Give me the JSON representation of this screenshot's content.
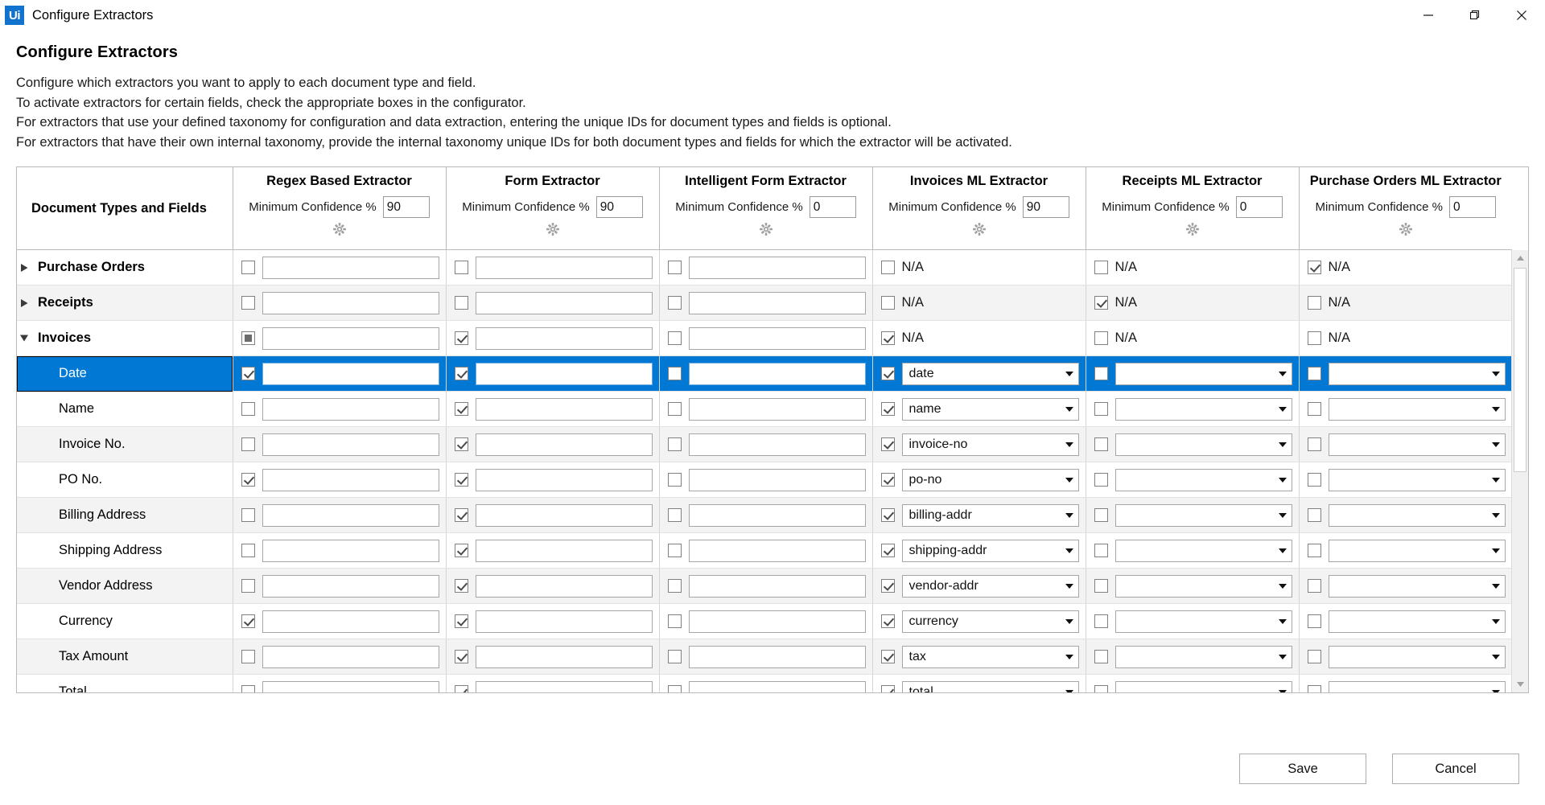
{
  "titlebar": {
    "logo_text": "Ui",
    "title": "Configure Extractors",
    "minimize_icon": "minimize-icon",
    "restore_icon": "restore-icon",
    "close_icon": "close-icon"
  },
  "page": {
    "title": "Configure Extractors",
    "description_lines": [
      "Configure which extractors you want to apply to each document type and field.",
      "To activate extractors for certain fields, check the appropriate boxes in the configurator.",
      "For extractors that use your defined taxonomy for configuration and data extraction, entering the unique IDs for document types and fields is optional.",
      "For extractors that have their own internal taxonomy, provide the internal taxonomy unique IDs for both document types and fields for which the extractor will be activated."
    ]
  },
  "grid": {
    "first_column_header": "Document Types and Fields",
    "confidence_label": "Minimum Confidence %",
    "settings_icon": "gear-icon",
    "columns": [
      {
        "title": "Regex Based Extractor",
        "confidence": "90",
        "type": "text"
      },
      {
        "title": "Form Extractor",
        "confidence": "90",
        "type": "text"
      },
      {
        "title": "Intelligent Form Extractor",
        "confidence": "0",
        "type": "text"
      },
      {
        "title": "Invoices ML Extractor",
        "confidence": "90",
        "type": "combo"
      },
      {
        "title": "Receipts ML Extractor",
        "confidence": "0",
        "type": "combo"
      },
      {
        "title": "Purchase Orders ML Extractor",
        "confidence": "0",
        "type": "combo"
      }
    ],
    "rows": [
      {
        "label": "Purchase Orders",
        "level": "group",
        "expanded": false,
        "expander_icon": "triangle-right-icon",
        "selected": false,
        "cells": [
          {
            "checked": "unchecked",
            "value": ""
          },
          {
            "checked": "unchecked",
            "value": ""
          },
          {
            "checked": "unchecked",
            "value": ""
          },
          {
            "checked": "unchecked",
            "value": "N/A"
          },
          {
            "checked": "unchecked",
            "value": "N/A"
          },
          {
            "checked": "checked",
            "value": "N/A"
          }
        ]
      },
      {
        "label": "Receipts",
        "level": "group",
        "expanded": false,
        "expander_icon": "triangle-right-icon",
        "selected": false,
        "cells": [
          {
            "checked": "unchecked",
            "value": ""
          },
          {
            "checked": "unchecked",
            "value": ""
          },
          {
            "checked": "unchecked",
            "value": ""
          },
          {
            "checked": "unchecked",
            "value": "N/A"
          },
          {
            "checked": "checked",
            "value": "N/A"
          },
          {
            "checked": "unchecked",
            "value": "N/A"
          }
        ]
      },
      {
        "label": "Invoices",
        "level": "group",
        "expanded": true,
        "expander_icon": "triangle-down-icon",
        "selected": false,
        "cells": [
          {
            "checked": "indeterminate",
            "value": ""
          },
          {
            "checked": "checked",
            "value": ""
          },
          {
            "checked": "unchecked",
            "value": ""
          },
          {
            "checked": "checked",
            "value": "N/A"
          },
          {
            "checked": "unchecked",
            "value": "N/A"
          },
          {
            "checked": "unchecked",
            "value": "N/A"
          }
        ]
      },
      {
        "label": "Date",
        "level": "child",
        "selected": true,
        "cells": [
          {
            "checked": "checked",
            "value": ""
          },
          {
            "checked": "checked",
            "value": ""
          },
          {
            "checked": "unchecked",
            "value": ""
          },
          {
            "checked": "checked",
            "value": "date"
          },
          {
            "checked": "unchecked",
            "value": ""
          },
          {
            "checked": "unchecked",
            "value": ""
          }
        ]
      },
      {
        "label": "Name",
        "level": "child",
        "selected": false,
        "cells": [
          {
            "checked": "unchecked",
            "value": ""
          },
          {
            "checked": "checked",
            "value": ""
          },
          {
            "checked": "unchecked",
            "value": ""
          },
          {
            "checked": "checked",
            "value": "name"
          },
          {
            "checked": "unchecked",
            "value": ""
          },
          {
            "checked": "unchecked",
            "value": ""
          }
        ]
      },
      {
        "label": "Invoice No.",
        "level": "child",
        "selected": false,
        "cells": [
          {
            "checked": "unchecked",
            "value": ""
          },
          {
            "checked": "checked",
            "value": ""
          },
          {
            "checked": "unchecked",
            "value": ""
          },
          {
            "checked": "checked",
            "value": "invoice-no"
          },
          {
            "checked": "unchecked",
            "value": ""
          },
          {
            "checked": "unchecked",
            "value": ""
          }
        ]
      },
      {
        "label": "PO No.",
        "level": "child",
        "selected": false,
        "cells": [
          {
            "checked": "checked",
            "value": ""
          },
          {
            "checked": "checked",
            "value": ""
          },
          {
            "checked": "unchecked",
            "value": ""
          },
          {
            "checked": "checked",
            "value": "po-no"
          },
          {
            "checked": "unchecked",
            "value": ""
          },
          {
            "checked": "unchecked",
            "value": ""
          }
        ]
      },
      {
        "label": "Billing Address",
        "level": "child",
        "selected": false,
        "cells": [
          {
            "checked": "unchecked",
            "value": ""
          },
          {
            "checked": "checked",
            "value": ""
          },
          {
            "checked": "unchecked",
            "value": ""
          },
          {
            "checked": "checked",
            "value": "billing-addr"
          },
          {
            "checked": "unchecked",
            "value": ""
          },
          {
            "checked": "unchecked",
            "value": ""
          }
        ]
      },
      {
        "label": "Shipping Address",
        "level": "child",
        "selected": false,
        "cells": [
          {
            "checked": "unchecked",
            "value": ""
          },
          {
            "checked": "checked",
            "value": ""
          },
          {
            "checked": "unchecked",
            "value": ""
          },
          {
            "checked": "checked",
            "value": "shipping-addr"
          },
          {
            "checked": "unchecked",
            "value": ""
          },
          {
            "checked": "unchecked",
            "value": ""
          }
        ]
      },
      {
        "label": "Vendor Address",
        "level": "child",
        "selected": false,
        "cells": [
          {
            "checked": "unchecked",
            "value": ""
          },
          {
            "checked": "checked",
            "value": ""
          },
          {
            "checked": "unchecked",
            "value": ""
          },
          {
            "checked": "checked",
            "value": "vendor-addr"
          },
          {
            "checked": "unchecked",
            "value": ""
          },
          {
            "checked": "unchecked",
            "value": ""
          }
        ]
      },
      {
        "label": "Currency",
        "level": "child",
        "selected": false,
        "cells": [
          {
            "checked": "checked",
            "value": ""
          },
          {
            "checked": "checked",
            "value": ""
          },
          {
            "checked": "unchecked",
            "value": ""
          },
          {
            "checked": "checked",
            "value": "currency"
          },
          {
            "checked": "unchecked",
            "value": ""
          },
          {
            "checked": "unchecked",
            "value": ""
          }
        ]
      },
      {
        "label": "Tax Amount",
        "level": "child",
        "selected": false,
        "cells": [
          {
            "checked": "unchecked",
            "value": ""
          },
          {
            "checked": "checked",
            "value": ""
          },
          {
            "checked": "unchecked",
            "value": ""
          },
          {
            "checked": "checked",
            "value": "tax"
          },
          {
            "checked": "unchecked",
            "value": ""
          },
          {
            "checked": "unchecked",
            "value": ""
          }
        ]
      },
      {
        "label": "Total",
        "level": "child",
        "selected": false,
        "cells": [
          {
            "checked": "unchecked",
            "value": ""
          },
          {
            "checked": "checked",
            "value": ""
          },
          {
            "checked": "unchecked",
            "value": ""
          },
          {
            "checked": "checked",
            "value": "total"
          },
          {
            "checked": "unchecked",
            "value": ""
          },
          {
            "checked": "unchecked",
            "value": ""
          }
        ]
      }
    ],
    "scrollbar": {
      "up_icon": "scroll-up-arrow-icon",
      "down_icon": "scroll-down-arrow-icon"
    }
  },
  "footer": {
    "save_label": "Save",
    "cancel_label": "Cancel"
  },
  "colors": {
    "accent": "#0078d4",
    "logo": "#1273cf",
    "grid_border": "#b9b9b9",
    "alt_row": "#f3f3f3"
  }
}
